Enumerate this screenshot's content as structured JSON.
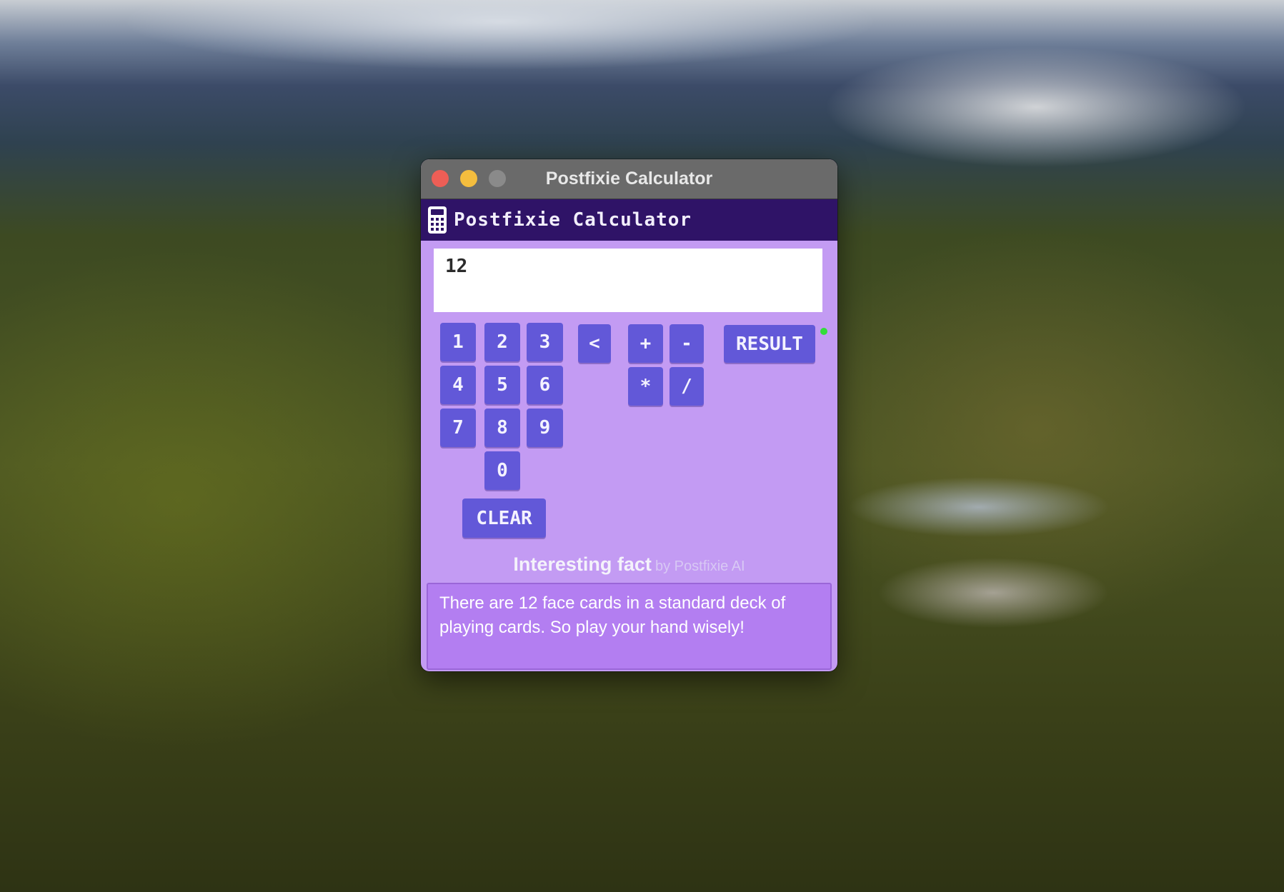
{
  "window": {
    "title": "Postfixie Calculator"
  },
  "app": {
    "title": "Postfixie Calculator",
    "icon": "calculator-icon"
  },
  "display": {
    "value": "12"
  },
  "keypad": {
    "digits": [
      "1",
      "2",
      "3",
      "4",
      "5",
      "6",
      "7",
      "8",
      "9",
      "0"
    ],
    "backspace": "<",
    "operators": [
      "+",
      "-",
      "*",
      "/"
    ],
    "result": "RESULT",
    "clear": "CLEAR"
  },
  "status": {
    "indicator_color": "#33dd3a"
  },
  "fact": {
    "heading": "Interesting fact",
    "byline": "by Postfixie AI",
    "text": "There are 12 face cards in a standard deck of playing cards. So play your hand wisely!"
  },
  "colors": {
    "titlebar": "#6a6a6a",
    "app_header": "#2f1367",
    "panel": "#c39bf3",
    "button": "#6258d8",
    "fact_box": "#b37ef1"
  }
}
